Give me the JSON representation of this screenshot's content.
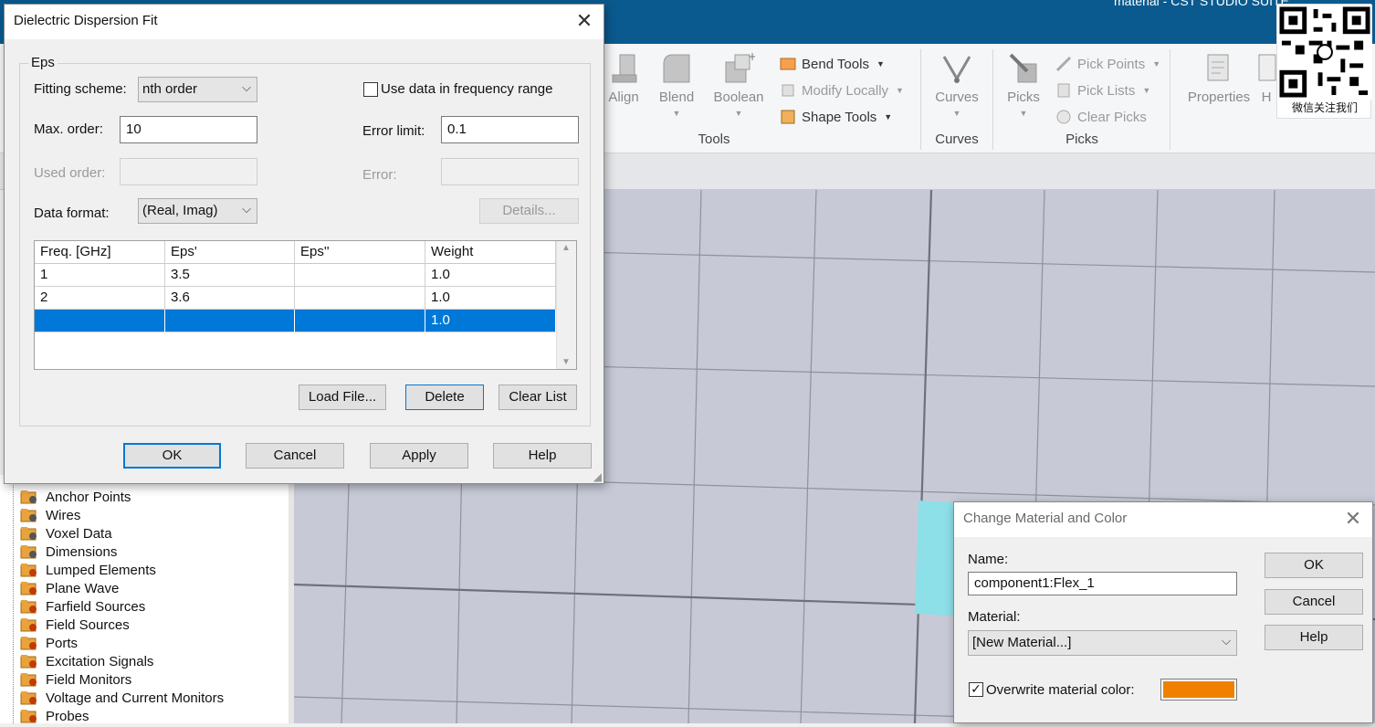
{
  "app": {
    "title": "material - CST STUDIO SUITE"
  },
  "ribbon": {
    "tools_group": {
      "align": "Align",
      "blend": "Blend",
      "boolean": "Boolean",
      "bend_tools": "Bend Tools",
      "modify_locally": "Modify Locally",
      "shape_tools": "Shape Tools",
      "label": "Tools"
    },
    "curves_group": {
      "curves": "Curves",
      "label": "Curves"
    },
    "picks_group": {
      "picks": "Picks",
      "pick_points": "Pick Points",
      "pick_lists": "Pick Lists",
      "clear_picks": "Clear Picks",
      "label": "Picks"
    },
    "properties": "Properties",
    "partial_item": "H"
  },
  "qr": {
    "caption": "微信关注我们"
  },
  "nav_tree": {
    "items": [
      "Anchor Points",
      "Wires",
      "Voxel Data",
      "Dimensions",
      "Lumped Elements",
      "Plane Wave",
      "Farfield Sources",
      "Field Sources",
      "Ports",
      "Excitation Signals",
      "Field Monitors",
      "Voltage and Current Monitors",
      "Probes"
    ]
  },
  "dispersion_dialog": {
    "title": "Dielectric Dispersion Fit",
    "group_label": "Eps",
    "fitting_scheme_label": "Fitting scheme:",
    "fitting_scheme_value": "nth order",
    "use_data_label": "Use data in frequency range",
    "max_order_label": "Max. order:",
    "max_order_value": "10",
    "error_limit_label": "Error limit:",
    "error_limit_value": "0.1",
    "used_order_label": "Used order:",
    "error_label": "Error:",
    "data_format_label": "Data format:",
    "data_format_value": "(Real, Imag)",
    "details_button": "Details...",
    "table": {
      "headers": [
        "Freq. [GHz]",
        "Eps'",
        "Eps''",
        "Weight"
      ],
      "rows": [
        [
          "1",
          "3.5",
          "",
          "1.0"
        ],
        [
          "2",
          "3.6",
          "",
          "1.0"
        ],
        [
          "",
          "",
          "",
          "1.0"
        ]
      ]
    },
    "load_file_button": "Load File...",
    "delete_button": "Delete",
    "clear_list_button": "Clear List",
    "ok_button": "OK",
    "cancel_button": "Cancel",
    "apply_button": "Apply",
    "help_button": "Help"
  },
  "material_dialog": {
    "title": "Change Material and Color",
    "name_label": "Name:",
    "name_value": "component1:Flex_1",
    "material_label": "Material:",
    "material_value": "[New Material...]",
    "overwrite_label": "Overwrite material color:",
    "overwrite_checked": true,
    "color": "#f08000",
    "ok_button": "OK",
    "cancel_button": "Cancel",
    "help_button": "Help"
  },
  "colors": {
    "titlebar": "#0a5a8f",
    "selection": "#0078d7",
    "highlight_face": "#8ddfe8"
  }
}
